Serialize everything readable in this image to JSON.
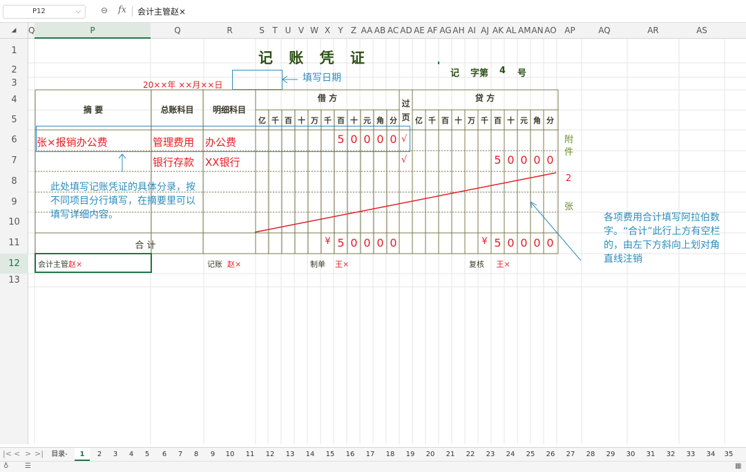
{
  "formula_bar": {
    "cell_ref": "P12",
    "zoom_glyph": "⊖",
    "fx_label": "fx",
    "content": "会计主管赵×"
  },
  "column_headers": [
    "Q",
    "P",
    "Q",
    "R",
    "S",
    "T",
    "U",
    "V",
    "W",
    "X",
    "Y",
    "Z",
    "AA",
    "AB",
    "AC",
    "AD",
    "AE",
    "AF",
    "AG",
    "AH",
    "AI",
    "AJ",
    "AK",
    "AL",
    "AM",
    "AN",
    "AO",
    "AP",
    "AQ",
    "AR",
    "AS"
  ],
  "row_headers": [
    "1",
    "2",
    "3",
    "4",
    "5",
    "6",
    "7",
    "8",
    "9",
    "10",
    "11",
    "12",
    "13"
  ],
  "voucher": {
    "title": "记 账 凭 证",
    "ji": "记",
    "zi_di": "字第",
    "number": "4",
    "hao": "号",
    "date_prefix": "20××年 ××月×",
    "date_suffix": "×日",
    "date_annotation": "填写日期",
    "headers": {
      "summary": "摘      要",
      "general_account": "总账科目",
      "detail_account": "明细科目",
      "debit": "借      方",
      "posted": "过\n页",
      "credit": "贷      方"
    },
    "digit_units": [
      "亿",
      "千",
      "百",
      "十",
      "万",
      "千",
      "百",
      "十",
      "元",
      "角",
      "分"
    ],
    "rows": [
      {
        "summary": "张×报销办公费",
        "general": "管理费用",
        "detail": "办公费",
        "debit_digits": [
          "",
          "",
          "",
          "",
          "",
          "",
          "5",
          "0",
          "0",
          "0",
          "0"
        ],
        "posted": "√",
        "credit_digits": [
          "",
          "",
          "",
          "",
          "",
          "",
          "",
          "",
          "",
          "",
          ""
        ]
      },
      {
        "summary": "",
        "general": "银行存款",
        "detail": "XX银行",
        "debit_digits": [
          "",
          "",
          "",
          "",
          "",
          "",
          "",
          "",
          "",
          "",
          ""
        ],
        "posted": "√",
        "credit_digits": [
          "",
          "",
          "",
          "",
          "",
          "",
          "5",
          "0",
          "0",
          "0",
          "0"
        ]
      }
    ],
    "entry_note": "此处填写记账凭证的具体分录，按不同项目分行填写，在摘要里可以填写详细内容。",
    "total_label": "合          计",
    "debit_total": [
      "¥",
      "5",
      "0",
      "0",
      "0",
      "0"
    ],
    "credit_total": [
      "¥",
      "5",
      "0",
      "0",
      "0",
      "0"
    ],
    "attachment_label": "附\n件",
    "attachment_count": "2",
    "attachment_unit": "张",
    "total_note": "各项费用合计填写阿拉伯数字。“合计”此行上方有空栏的，由左下方斜向上划对角直线注销",
    "footer": {
      "supervisor_label": "会计主管",
      "supervisor_name": "赵×",
      "bookkeeper_label": "记账",
      "bookkeeper_name": "赵×",
      "preparer_label": "制单",
      "preparer_name": "王×",
      "reviewer_label": "复核",
      "reviewer_name": "王×"
    }
  },
  "sheet_tabs": [
    "目录-",
    "1",
    "2",
    "3",
    "4",
    "5",
    "6",
    "7",
    "8",
    "9",
    "10",
    "11",
    "12",
    "13",
    "14",
    "15",
    "16",
    "17",
    "18",
    "19",
    "20",
    "21",
    "22",
    "23",
    "24",
    "25",
    "26",
    "27",
    "28",
    "29",
    "30",
    "31",
    "32",
    "33",
    "34",
    "35"
  ],
  "active_tab": "1",
  "nav_glyphs": [
    "|<",
    "<",
    ">",
    ">|"
  ],
  "colors": {
    "red": "#e51c23",
    "blue": "#2b8cbe",
    "olive": "#6a8a2a",
    "selection_green": "#217346"
  }
}
